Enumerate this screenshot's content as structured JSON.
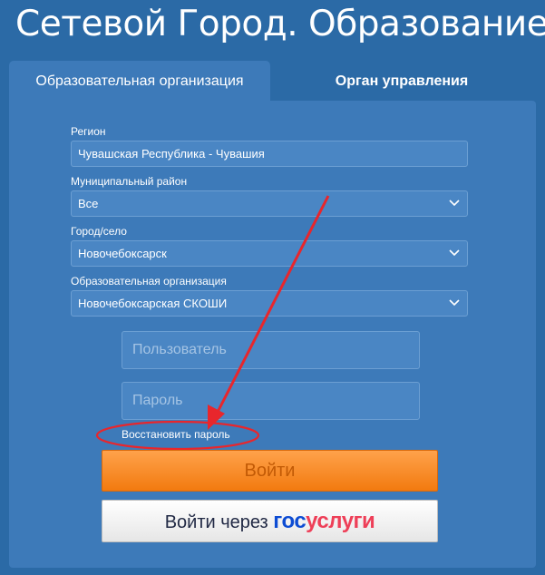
{
  "app": {
    "title": "Сетевой Город. Образование"
  },
  "tabs": [
    {
      "label": "Образовательная организация",
      "active": true
    },
    {
      "label": "Орган управления",
      "active": false
    }
  ],
  "form": {
    "region": {
      "label": "Регион",
      "value": "Чувашская Республика - Чувашия"
    },
    "district": {
      "label": "Муниципальный район",
      "value": "Все"
    },
    "city": {
      "label": "Город/село",
      "value": "Новочебоксарск"
    },
    "organization": {
      "label": "Образовательная организация",
      "value": "Новочебоксарская СКОШИ"
    },
    "username": {
      "placeholder": "Пользователь",
      "value": ""
    },
    "password": {
      "placeholder": "Пароль",
      "value": ""
    },
    "restore_link": "Восстановить пароль",
    "login_button": "Войти",
    "gosuslugi_button": {
      "prefix": "Войти через",
      "logo_part1": "гос",
      "logo_part2": "услуги"
    }
  },
  "colors": {
    "background": "#2b6aa6",
    "panel": "#3d7ab9",
    "login_button": "#f7891f",
    "annotation": "#e8262c",
    "gosuslugi_blue": "#0d4cd3",
    "gosuslugi_red": "#ee3f58"
  }
}
